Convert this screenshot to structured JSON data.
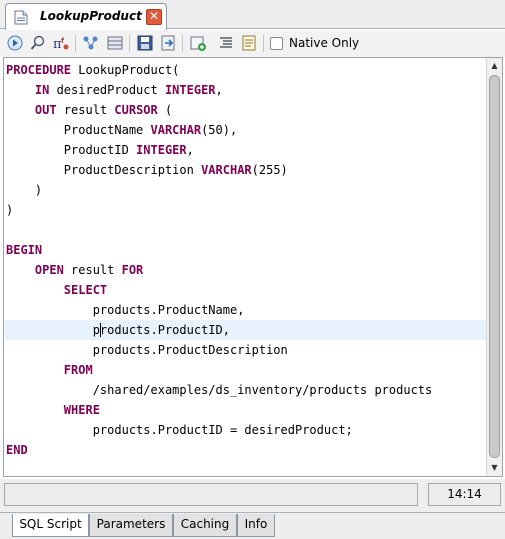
{
  "editor_tab": {
    "title": "LookupProduct",
    "close_glyph": "✕"
  },
  "toolbar": {
    "icons": [
      "run-icon",
      "find-icon",
      "insert-function-icon",
      "explain-plan-icon",
      "save-icon",
      "export-icon",
      "import-icon",
      "add-icon",
      "format-icon",
      "document-icon"
    ],
    "native_only_label": "Native Only",
    "native_only_checked": false
  },
  "editor": {
    "current_line_index": 13,
    "lines": [
      [
        {
          "t": "PROCEDURE",
          "k": true
        },
        {
          "t": " LookupProduct("
        }
      ],
      [
        {
          "t": "    "
        },
        {
          "t": "IN",
          "k": true
        },
        {
          "t": " desiredProduct "
        },
        {
          "t": "INTEGER",
          "k": true
        },
        {
          "t": ","
        }
      ],
      [
        {
          "t": "    "
        },
        {
          "t": "OUT",
          "k": true
        },
        {
          "t": " result "
        },
        {
          "t": "CURSOR",
          "k": true
        },
        {
          "t": " ("
        }
      ],
      [
        {
          "t": "        ProductName "
        },
        {
          "t": "VARCHAR",
          "k": true
        },
        {
          "t": "(50),"
        }
      ],
      [
        {
          "t": "        ProductID "
        },
        {
          "t": "INTEGER",
          "k": true
        },
        {
          "t": ","
        }
      ],
      [
        {
          "t": "        ProductDescription "
        },
        {
          "t": "VARCHAR",
          "k": true
        },
        {
          "t": "(255)"
        }
      ],
      [
        {
          "t": "    )"
        }
      ],
      [
        {
          "t": ")"
        }
      ],
      [
        {
          "t": ""
        }
      ],
      [
        {
          "t": "BEGIN",
          "k": true
        }
      ],
      [
        {
          "t": "    "
        },
        {
          "t": "OPEN",
          "k": true
        },
        {
          "t": " result "
        },
        {
          "t": "FOR",
          "k": true
        }
      ],
      [
        {
          "t": "        "
        },
        {
          "t": "SELECT",
          "k": true
        }
      ],
      [
        {
          "t": "            products.ProductName,"
        }
      ],
      [
        {
          "t": "            products.ProductID,"
        }
      ],
      [
        {
          "t": "            products.ProductDescription"
        }
      ],
      [
        {
          "t": "        "
        },
        {
          "t": "FROM",
          "k": true
        }
      ],
      [
        {
          "t": "            /shared/examples/ds_inventory/products products"
        }
      ],
      [
        {
          "t": "        "
        },
        {
          "t": "WHERE",
          "k": true
        }
      ],
      [
        {
          "t": "            products.ProductID = desiredProduct;"
        }
      ],
      [
        {
          "t": "END",
          "k": true
        }
      ]
    ]
  },
  "status": {
    "message": "",
    "cursor_position": "14:14"
  },
  "bottom_tabs": [
    {
      "label": "SQL Script",
      "active": true
    },
    {
      "label": "Parameters",
      "active": false
    },
    {
      "label": "Caching",
      "active": false
    },
    {
      "label": "Info",
      "active": false
    }
  ]
}
